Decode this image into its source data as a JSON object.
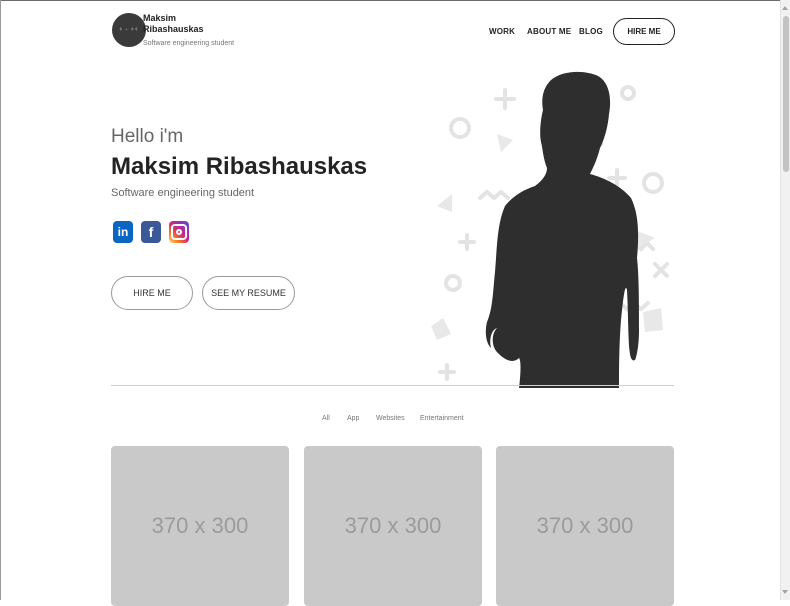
{
  "header": {
    "logo_text": "ǂ • ǂǂ",
    "brand_name": "Maksim Ribashauskas",
    "brand_subtitle": "Software engineering student",
    "nav": {
      "work": "WORK",
      "about": "ABOUT ME",
      "blog": "BLOG",
      "hire": "HIRE ME"
    }
  },
  "hero": {
    "greeting": "Hello i'm",
    "name": "Maksim Ribashauskas",
    "subtitle": "Software engineering student",
    "social": {
      "linkedin": "in",
      "facebook": "f"
    },
    "buttons": {
      "hire": "HIRE ME",
      "resume": "SEE MY RESUME"
    }
  },
  "portfolio": {
    "filters": [
      "All",
      "App",
      "Websites",
      "Entertainment"
    ],
    "cards": [
      "370 x 300",
      "370 x 300",
      "370 x 300"
    ]
  },
  "colors": {
    "text_dark": "#232323",
    "silhouette": "#2e2e2e",
    "decor": "#e3e3e3",
    "card_bg": "#c9c9c9",
    "linkedin": "#0a66c2",
    "facebook": "#3b5998"
  }
}
